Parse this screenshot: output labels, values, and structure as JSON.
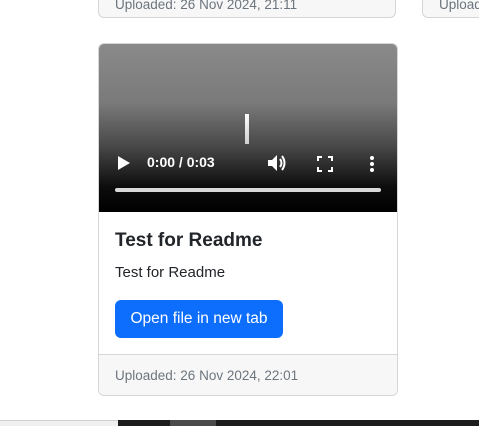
{
  "previous_cards": {
    "left_footer": "Uploaded: 26 Nov 2024, 21:11",
    "right_footer": "Uploaded"
  },
  "card": {
    "video": {
      "time": "0:00 / 0:03",
      "icons": [
        "play-icon",
        "volume-icon",
        "fullscreen-icon",
        "more-options-icon"
      ],
      "progress": 0
    },
    "title": "Test for Readme",
    "description": "Test for Readme",
    "button_label": "Open file in new tab",
    "footer": "Uploaded: 26 Nov 2024, 22:01"
  },
  "colors": {
    "primary": "#0d6efd",
    "footer_bg": "#f7f7f7",
    "muted_text": "#6c757d"
  }
}
